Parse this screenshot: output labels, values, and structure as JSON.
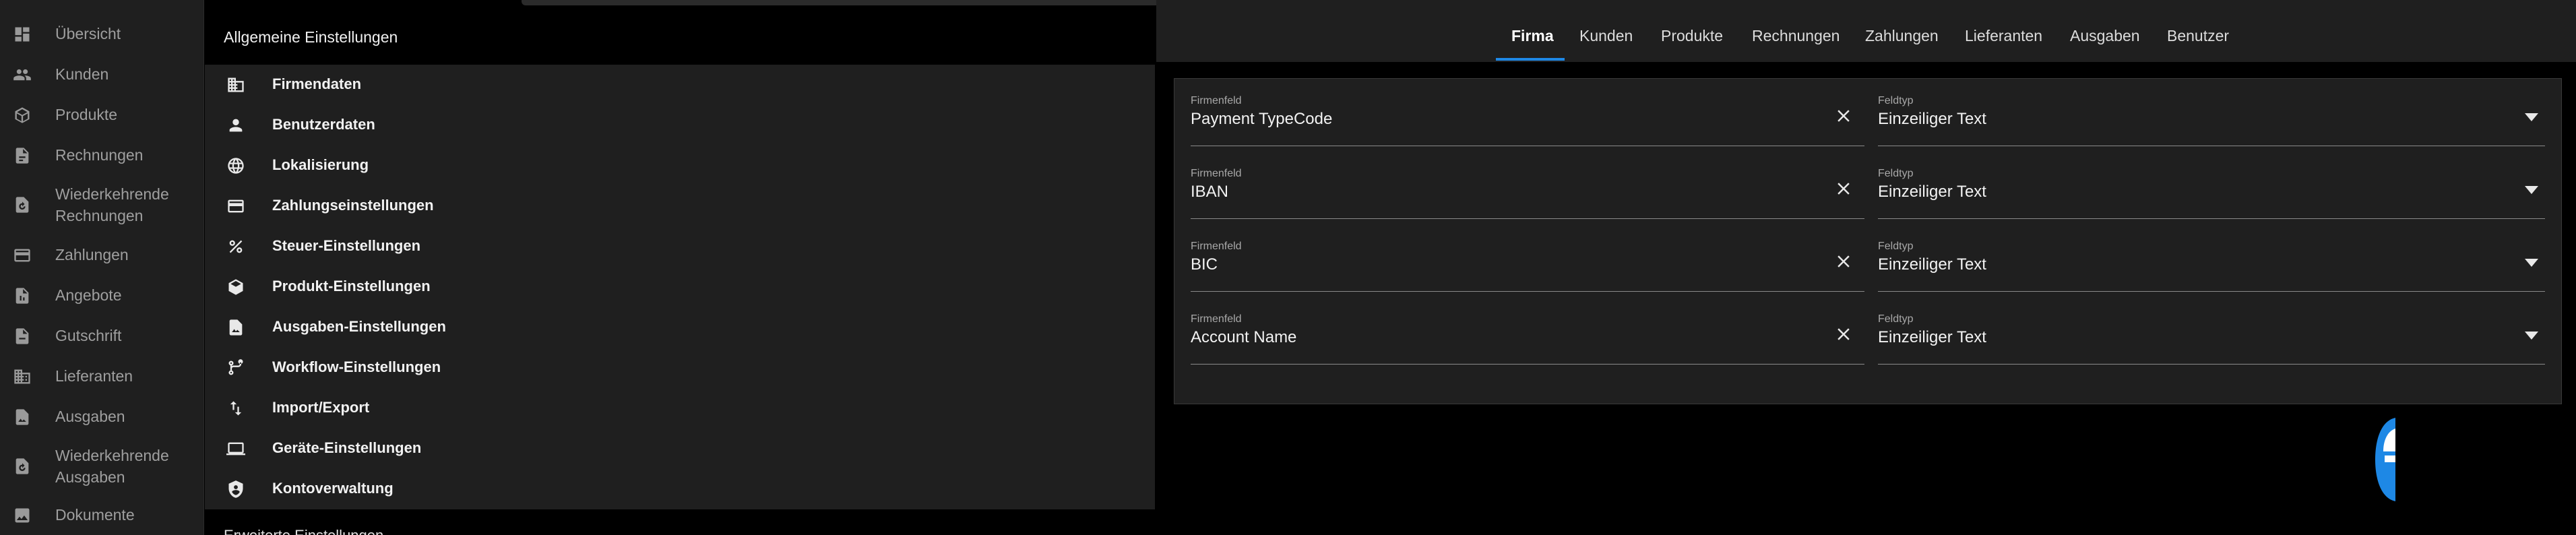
{
  "nav": {
    "items": [
      {
        "label": "Übersicht",
        "icon": "dashboard-icon"
      },
      {
        "label": "Kunden",
        "icon": "users-icon"
      },
      {
        "label": "Produkte",
        "icon": "box-icon"
      },
      {
        "label": "Rechnungen",
        "icon": "invoice-icon"
      },
      {
        "label": "Wiederkehrende\nRechnungen",
        "icon": "recurring-invoice-icon"
      },
      {
        "label": "Zahlungen",
        "icon": "credit-card-icon"
      },
      {
        "label": "Angebote",
        "icon": "quote-icon"
      },
      {
        "label": "Gutschrift",
        "icon": "credit-note-icon"
      },
      {
        "label": "Lieferanten",
        "icon": "building-icon"
      },
      {
        "label": "Ausgaben",
        "icon": "expense-icon"
      },
      {
        "label": "Wiederkehrende\nAusgaben",
        "icon": "recurring-expense-icon"
      },
      {
        "label": "Dokumente",
        "icon": "image-icon"
      }
    ]
  },
  "settings": {
    "general_header": "Allgemeine Einstellungen",
    "items": [
      {
        "label": "Firmendaten",
        "icon": "company-icon"
      },
      {
        "label": "Benutzerdaten",
        "icon": "person-icon"
      },
      {
        "label": "Lokalisierung",
        "icon": "globe-icon"
      },
      {
        "label": "Zahlungseinstellungen",
        "icon": "credit-card-icon"
      },
      {
        "label": "Steuer-Einstellungen",
        "icon": "percent-icon"
      },
      {
        "label": "Produkt-Einstellungen",
        "icon": "box-icon"
      },
      {
        "label": "Ausgaben-Einstellungen",
        "icon": "expense-icon"
      },
      {
        "label": "Workflow-Einstellungen",
        "icon": "workflow-icon"
      },
      {
        "label": "Import/Export",
        "icon": "import-export-icon"
      },
      {
        "label": "Geräte-Einstellungen",
        "icon": "laptop-icon"
      },
      {
        "label": "Kontoverwaltung",
        "icon": "shield-icon"
      }
    ],
    "advanced_header": "Erweiterte Einstellungen"
  },
  "tabs": [
    {
      "label": "Firma",
      "active": true
    },
    {
      "label": "Kunden",
      "active": false
    },
    {
      "label": "Produkte",
      "active": false
    },
    {
      "label": "Rechnungen",
      "active": false
    },
    {
      "label": "Zahlungen",
      "active": false
    },
    {
      "label": "Lieferanten",
      "active": false
    },
    {
      "label": "Ausgaben",
      "active": false
    },
    {
      "label": "Benutzer",
      "active": false
    }
  ],
  "custom_fields": {
    "field_label": "Firmenfeld",
    "type_label": "Feldtyp",
    "rows": [
      {
        "field": "Payment TypeCode",
        "type": "Einzeiliger Text"
      },
      {
        "field": "IBAN",
        "type": "Einzeiliger Text"
      },
      {
        "field": "BIC",
        "type": "Einzeiliger Text"
      },
      {
        "field": "Account Name",
        "type": "Einzeiliger Text"
      }
    ]
  },
  "colors": {
    "accent": "#1e88e5",
    "surface": "#1f1f1f",
    "background": "#000000"
  }
}
